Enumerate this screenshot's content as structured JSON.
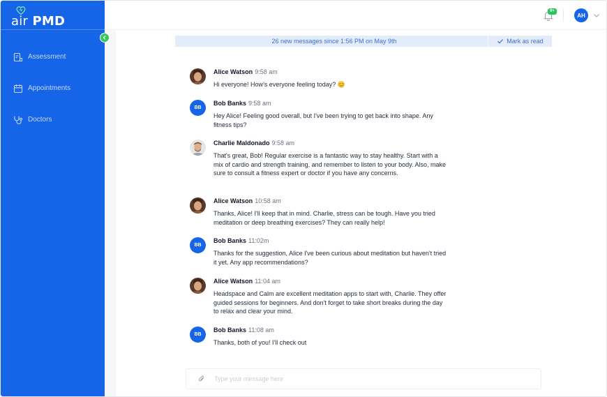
{
  "brand": {
    "name_prefix": "air",
    "name_suffix": "PMD",
    "logo_icon": "heart-logo-icon"
  },
  "sidebar": {
    "items": [
      {
        "label": "Assessment",
        "icon": "assessment-icon"
      },
      {
        "label": "Appointments",
        "icon": "calendar-icon"
      },
      {
        "label": "Doctors",
        "icon": "stethoscope-icon"
      }
    ],
    "collapse_icon": "chevron-left-icon"
  },
  "header": {
    "notification_badge": "9+",
    "user_initials": "AH"
  },
  "banner": {
    "text": "26 new messages since 1:56 PM on May 9th",
    "mark_read_label": "Mark as read"
  },
  "messages": [
    {
      "author": "Alice Watson",
      "time": "9:58 am",
      "text": "Hi everyone! How's everyone feeling today? 😊",
      "avatar": "photo"
    },
    {
      "author": "Bob Banks",
      "time": "9:58 am",
      "text": "Hey Alice! Feeling good overall, but I've been trying to get back into shape. Any fitness tips?",
      "avatar": "initials",
      "initials": "BB"
    },
    {
      "author": "Charlie Maldonado",
      "time": "9:58 am",
      "text": "That's great, Bob! Regular exercise is a fantastic way to stay healthy. Start with a mix of cardio and strength training, and remember to listen to your body. Also, make sure to consult a fitness expert or doctor if you have any concerns.",
      "avatar": "photo"
    },
    {
      "author": "Alice Watson",
      "time": "10:58 am",
      "text": "Thanks, Alice! I'll keep that in mind. Charlie, stress can be tough. Have you tried meditation or deep breathing exercises? They can really help!",
      "avatar": "photo"
    },
    {
      "author": "Bob Banks",
      "time": "11:02m",
      "text": "Thanks for the suggestion, Alice I've been curious about meditation but haven't tried it yet. Any app recommendations?",
      "avatar": "initials",
      "initials": "BB"
    },
    {
      "author": "Alice Watson",
      "time": "11:04 am",
      "text": "Headspace and Calm are excellent meditation apps to start with, Charlie. They offer guided sessions for beginners. And don't forget to take short breaks during the day to relax and clear your mind.",
      "avatar": "photo"
    },
    {
      "author": "Bob Banks",
      "time": "11:08 am",
      "text": "Thanks, both of you! I'll check out",
      "avatar": "initials",
      "initials": "BB"
    }
  ],
  "composer": {
    "value": "",
    "placeholder": "Type your message here",
    "attach_icon": "paperclip-icon"
  },
  "colors": {
    "brand_blue": "#1664e8",
    "accent_green": "#34c759",
    "banner_bg": "#e3ecfb"
  }
}
